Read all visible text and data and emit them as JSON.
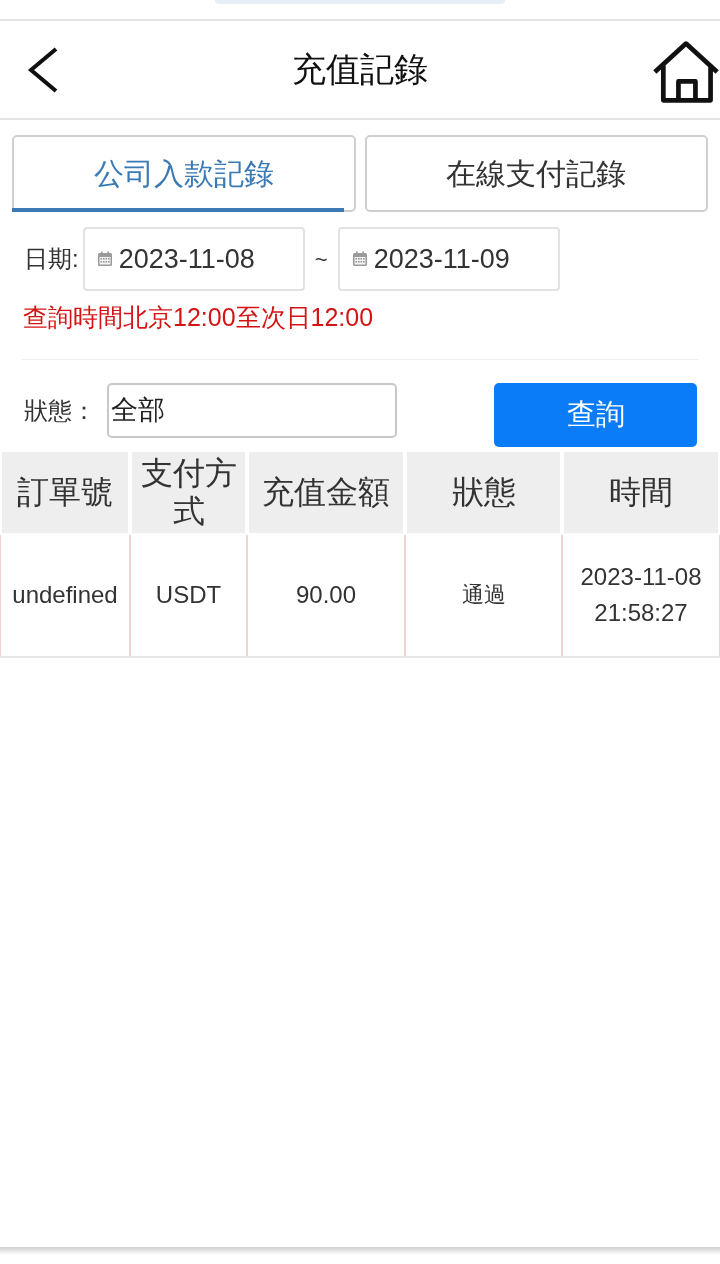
{
  "header": {
    "title": "充值記錄"
  },
  "tabs": [
    {
      "label": "公司入款記錄",
      "selected": true
    },
    {
      "label": "在線支付記錄",
      "selected": false
    }
  ],
  "date_filter": {
    "label": "日期:",
    "from": "2023-11-08",
    "separator": "~",
    "to": "2023-11-09"
  },
  "note": "查詢時間北京12:00至次日12:00",
  "status_filter": {
    "label": "狀態：",
    "value": "全部"
  },
  "query_button": "查詢",
  "table": {
    "columns": [
      "訂單號",
      "支付方式",
      "充值金額",
      "狀態",
      "時間"
    ],
    "rows": [
      [
        "undefined",
        "USDT",
        "90.00",
        "通過",
        "2023-11-08 21:58:27"
      ]
    ]
  }
}
